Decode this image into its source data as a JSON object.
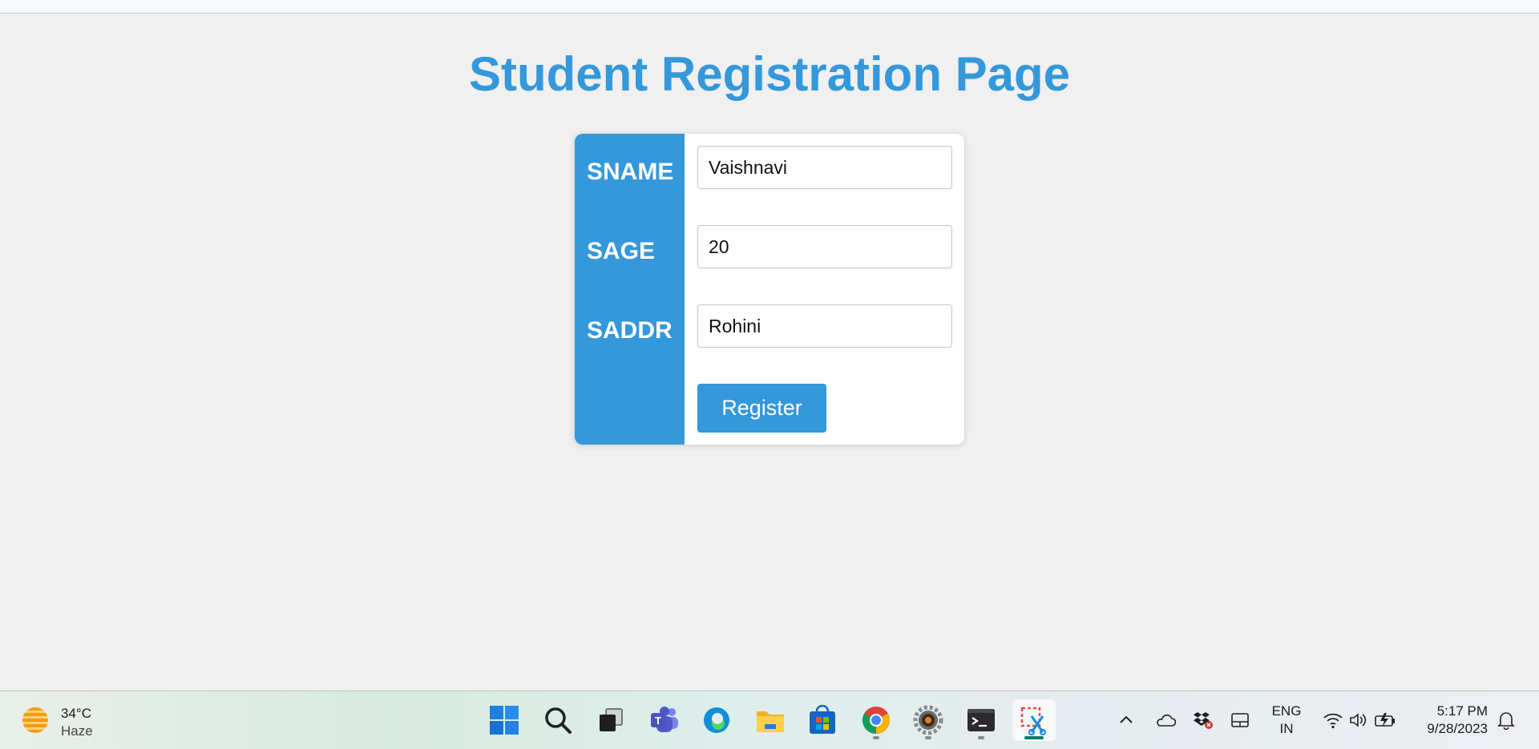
{
  "page": {
    "title": "Student Registration Page",
    "accent_color": "#3498db"
  },
  "form": {
    "fields": [
      {
        "label": "SNAME",
        "value": "Vaishnavi"
      },
      {
        "label": "SAGE",
        "value": "20"
      },
      {
        "label": "SADDR",
        "value": "Rohini"
      }
    ],
    "submit_label": "Register"
  },
  "taskbar": {
    "weather": {
      "temp": "34°C",
      "condition": "Haze",
      "icon": "sun-haze-icon"
    },
    "apps": [
      {
        "name": "start-icon"
      },
      {
        "name": "search-icon"
      },
      {
        "name": "task-view-icon"
      },
      {
        "name": "teams-icon"
      },
      {
        "name": "edge-icon"
      },
      {
        "name": "file-explorer-icon"
      },
      {
        "name": "store-icon"
      },
      {
        "name": "chrome-icon"
      },
      {
        "name": "settings-app-icon"
      },
      {
        "name": "terminal-icon"
      },
      {
        "name": "snipping-tool-icon"
      }
    ],
    "tray": {
      "lang_top": "ENG",
      "lang_bottom": "IN",
      "time": "5:17 PM",
      "date": "9/28/2023"
    }
  }
}
